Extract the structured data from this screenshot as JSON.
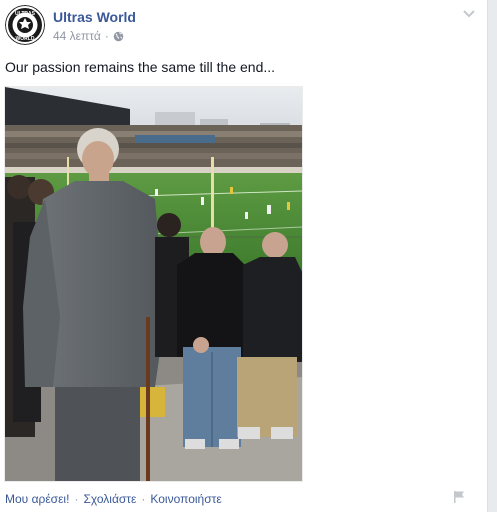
{
  "post": {
    "page_name": "Ultras World",
    "timestamp": "44 λεπτά",
    "separator": "·",
    "audience_icon": "globe-icon",
    "options_icon": "chevron-down-icon",
    "message": "Our passion remains the same till the end...",
    "avatar": {
      "icon": "ultras-world-logo",
      "top_text": "ULTRAS",
      "bottom_text": "WORLD"
    },
    "photo": {
      "description_icon": "stadium-photo"
    }
  },
  "actions": {
    "like_label": "Μου αρέσει!",
    "comment_label": "Σχολιάστε",
    "share_label": "Κοινοποιήστε",
    "separator": "·",
    "flag_icon": "flag-icon"
  },
  "colors": {
    "link": "#3b5998",
    "meta": "#9197a3",
    "text": "#141823",
    "pitch": "#4e8f3a"
  }
}
